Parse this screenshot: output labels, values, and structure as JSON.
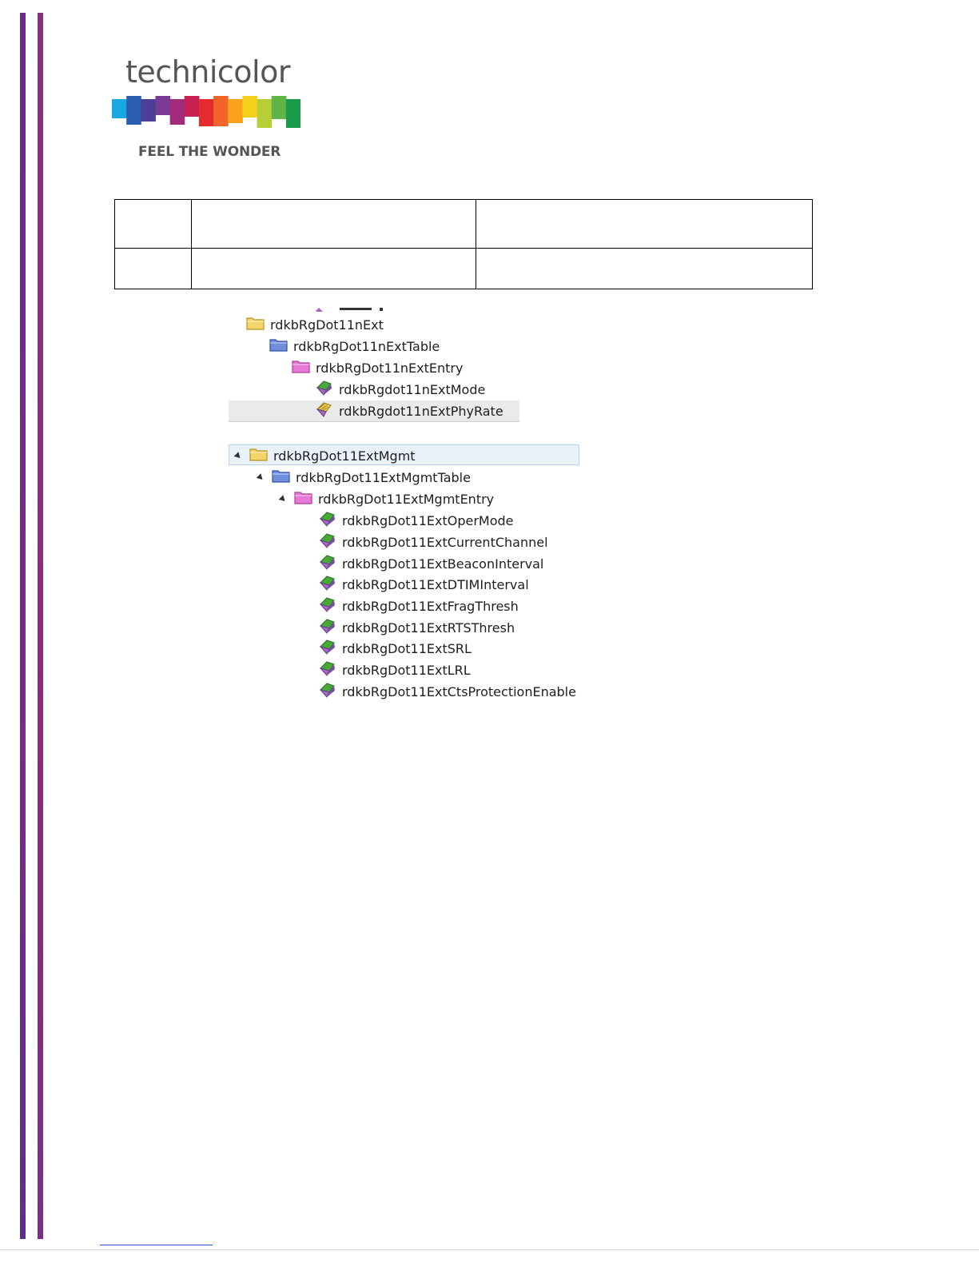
{
  "logo": {
    "wordmark": "technicolor",
    "tagline": "FEEL THE WONDER",
    "stripe_colors": [
      "#19a9e2",
      "#2a5fb0",
      "#4b3f96",
      "#7b3a94",
      "#a22a7b",
      "#c81f52",
      "#e52b2e",
      "#f2642a",
      "#f9a11b",
      "#f3d11b",
      "#b5cf35",
      "#5fb548",
      "#1a9a4a"
    ]
  },
  "table": {
    "rows": [
      [
        "",
        "",
        ""
      ],
      [
        "",
        "",
        ""
      ]
    ]
  },
  "tree1": {
    "partial_label": "",
    "nodes": [
      {
        "label": "rdkbRgDot11nExt",
        "icon": "folder-yellow-icon"
      },
      {
        "label": "rdkbRgDot11nExtTable",
        "icon": "folder-blue-icon"
      },
      {
        "label": "rdkbRgDot11nExtEntry",
        "icon": "folder-pink-icon"
      },
      {
        "label": "rdkbRgdot11nExtMode",
        "icon": "mib-leaf-icon"
      },
      {
        "label": "rdkbRgdot11nExtPhyRate",
        "icon": "mib-leaf-ro-icon"
      }
    ]
  },
  "tree2": {
    "nodes": [
      {
        "label": "rdkbRgDot11ExtMgmt",
        "icon": "folder-yellow-icon"
      },
      {
        "label": "rdkbRgDot11ExtMgmtTable",
        "icon": "folder-blue-icon"
      },
      {
        "label": "rdkbRgDot11ExtMgmtEntry",
        "icon": "folder-pink-icon"
      },
      {
        "label": "rdkbRgDot11ExtOperMode",
        "icon": "mib-leaf-icon"
      },
      {
        "label": "rdkbRgDot11ExtCurrentChannel",
        "icon": "mib-leaf-icon"
      },
      {
        "label": "rdkbRgDot11ExtBeaconInterval",
        "icon": "mib-leaf-icon"
      },
      {
        "label": "rdkbRgDot11ExtDTIMInterval",
        "icon": "mib-leaf-icon"
      },
      {
        "label": "rdkbRgDot11ExtFragThresh",
        "icon": "mib-leaf-icon"
      },
      {
        "label": "rdkbRgDot11ExtRTSThresh",
        "icon": "mib-leaf-icon"
      },
      {
        "label": "rdkbRgDot11ExtSRL",
        "icon": "mib-leaf-icon"
      },
      {
        "label": "rdkbRgDot11ExtLRL",
        "icon": "mib-leaf-icon"
      },
      {
        "label": "rdkbRgDot11ExtCtsProtectionEnable",
        "icon": "mib-leaf-icon"
      }
    ]
  },
  "colors": {
    "folder_yellow": "#f2d56b",
    "folder_blue": "#6f8fdc",
    "folder_pink": "#e77ad6",
    "leaf_green": "#49a83a",
    "leaf_purple": "#a46bc2",
    "selection_blue": "#e9f2fb"
  }
}
